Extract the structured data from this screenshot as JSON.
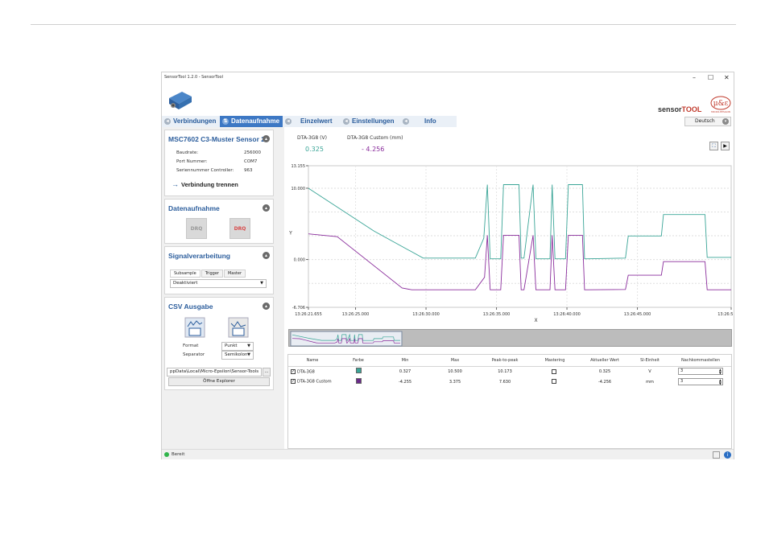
{
  "window": {
    "title": "SensorTool 1.2.0 - SensorTool",
    "controls": [
      "–",
      "☐",
      "✕"
    ]
  },
  "branding": {
    "sensor": "sensor",
    "tool": "TOOL",
    "logo_text": "MICRO-EPSILON"
  },
  "tabs": [
    {
      "label": "Verbindungen",
      "active": false
    },
    {
      "label": "Datenaufnahme",
      "active": true
    },
    {
      "label": "Einzelwert",
      "active": false
    },
    {
      "label": "Einstellungen",
      "active": false
    },
    {
      "label": "Info",
      "active": false
    }
  ],
  "language": "Deutsch",
  "sensor_panel": {
    "title": "MSC7602 C3-Muster Sensor 2",
    "rows": [
      {
        "label": "Baudrate:",
        "value": "256000"
      },
      {
        "label": "Port Nummer:",
        "value": "COM7"
      },
      {
        "label": "Seriennummer Controller:",
        "value": "963"
      }
    ],
    "disconnect": "Verbindung trennen"
  },
  "acq_panel": {
    "title": "Datenaufnahme",
    "btn1": "DRQ",
    "btn2": "DRQ"
  },
  "signal_panel": {
    "title": "Signalverarbeitung",
    "subtabs": [
      "Subsample",
      "Trigger",
      "Master"
    ],
    "select": "Deaktiviert"
  },
  "csv_panel": {
    "title": "CSV Ausgabe",
    "format_label": "Format",
    "format_value": "Punkt",
    "separator_label": "Separator",
    "separator_value": "Semikolon",
    "path": "ppData\\Local\\Micro-Epsilon\\Sensor-Tools",
    "browse": "...",
    "open_explorer": "Öffne Explorer"
  },
  "readout": {
    "ch1_label": "DTA-3G8 (V)",
    "ch1_value": "0.325",
    "ch2_label": "DTA-3G8 Custom (mm)",
    "ch2_value": "- 4.256",
    "color1": "#3aa597",
    "color2": "#8a2d9c"
  },
  "toolbar": {
    "fit": "⛶",
    "play": "▶"
  },
  "chart_data": {
    "type": "line",
    "xlabel": "X",
    "ylabel": "Y",
    "ylim": [
      -6.706,
      13.155
    ],
    "y_ticks": [
      "13.155",
      "10.000",
      "0.000",
      "-6.706"
    ],
    "x_ticks": [
      "13:26:21.655",
      "13:26:25.000",
      "13:26:30.000",
      "13:26:35.000",
      "13:26:40.000",
      "13:26:45.000",
      "13:26:51.655"
    ],
    "grid": true,
    "series": [
      {
        "name": "DTA-3G8",
        "color": "#3aa597",
        "x": [
          21.655,
          26.3,
          29.8,
          33.5,
          34.1,
          34.35,
          34.55,
          35.3,
          35.5,
          36.6,
          36.75,
          36.95,
          37.6,
          37.8,
          38.8,
          38.95,
          39.15,
          39.9,
          40.1,
          41.1,
          41.25,
          41.5,
          44.15,
          44.35,
          46.7,
          46.85,
          49.8,
          49.95,
          51.655
        ],
        "y": [
          10.0,
          4.0,
          0.2,
          0.2,
          3.0,
          10.5,
          0.1,
          0.1,
          10.5,
          10.5,
          0.2,
          0.2,
          10.5,
          0.1,
          0.1,
          10.5,
          0.1,
          0.1,
          10.5,
          10.5,
          0.1,
          0.1,
          0.2,
          3.3,
          3.3,
          6.3,
          6.3,
          0.3,
          0.3
        ]
      },
      {
        "name": "DTA-3G8 Custom",
        "color": "#8a2d9c",
        "x": [
          21.655,
          23.7,
          28.3,
          29.0,
          33.5,
          34.15,
          34.35,
          34.55,
          35.3,
          35.5,
          36.6,
          36.75,
          36.95,
          37.6,
          37.8,
          38.8,
          38.95,
          39.15,
          39.9,
          40.1,
          41.1,
          41.25,
          41.5,
          44.15,
          44.35,
          46.7,
          46.85,
          49.8,
          49.95,
          51.655
        ],
        "y": [
          3.6,
          3.2,
          -4.0,
          -4.25,
          -4.25,
          -2.5,
          3.4,
          -4.25,
          -4.25,
          3.4,
          3.4,
          -4.25,
          -4.25,
          3.4,
          -4.25,
          -4.25,
          3.4,
          -4.25,
          -4.25,
          3.4,
          3.4,
          -4.25,
          -4.25,
          -4.2,
          -2.2,
          -2.2,
          -0.3,
          -0.3,
          -4.25,
          -4.25
        ]
      }
    ]
  },
  "table": {
    "headers": [
      "Name",
      "Farbe",
      "Min",
      "Max",
      "Peak-to-peak",
      "Mastering",
      "Aktueller Wert",
      "SI-Einheit",
      "Nachkommastellen"
    ],
    "rows": [
      {
        "name": "DTA-3G8",
        "color": "#3aa597",
        "min": "0.327",
        "max": "10.500",
        "p2p": "10.173",
        "actual": "0.325",
        "unit": "V",
        "decimals": "3"
      },
      {
        "name": "DTA-3G8 Custom",
        "color": "#6a2a8a",
        "min": "-4.255",
        "max": "3.375",
        "p2p": "7.630",
        "actual": "-4.256",
        "unit": "mm",
        "decimals": "3"
      }
    ]
  },
  "status": {
    "text": "Bereit",
    "color": "#31b44b"
  }
}
